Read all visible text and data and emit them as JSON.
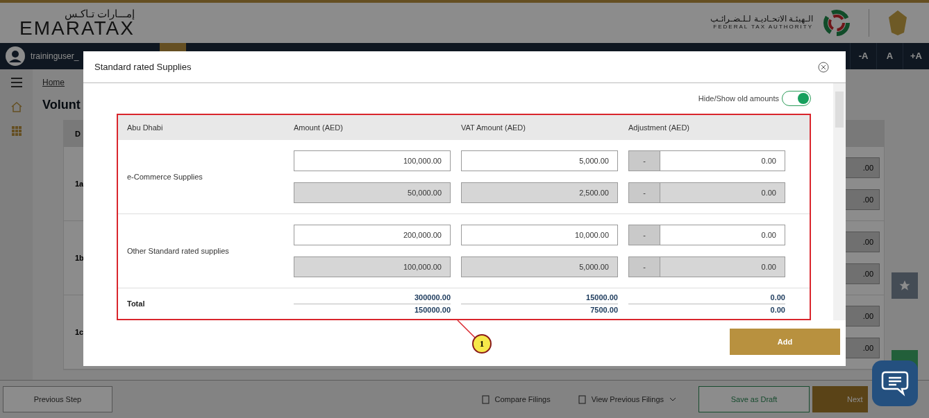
{
  "header": {
    "logo_arabic": "إمـــارات تـاكـس",
    "logo_text": "EMARATAX",
    "authority_arabic": "الـهيئـة الاتحـاديـة لـلـضـرائـب",
    "authority_english": "FEDERAL TAX AUTHORITY"
  },
  "navbar": {
    "user": "traininguser_",
    "font_buttons": [
      "-A",
      "A",
      "+A"
    ]
  },
  "breadcrumb": [
    "Home"
  ],
  "page_title": "Volunt",
  "background_table": {
    "header": "D",
    "rows": [
      {
        "label": "1a",
        "values": [
          ".00",
          ".00"
        ]
      },
      {
        "label": "1b",
        "values": [
          ".00",
          ".00"
        ]
      },
      {
        "label": "1c",
        "values": [
          ".00",
          ".00"
        ]
      }
    ]
  },
  "footer": {
    "previous": "Previous Step",
    "links": [
      "Compare Filings",
      "View Previous Filings"
    ],
    "save": "Save as Draft",
    "next": "Next"
  },
  "modal": {
    "title": "Standard rated Supplies",
    "toggle": {
      "label": "Hide/Show old amounts",
      "on": true
    },
    "columns": [
      "Abu Dhabi",
      "Amount (AED)",
      "VAT Amount (AED)",
      "Adjustment (AED)"
    ],
    "rows": [
      {
        "label": "e-Commerce Supplies",
        "entries": [
          {
            "kind": "current",
            "amount": "100,000.00",
            "vat": "5,000.00",
            "sign": "-",
            "adjustment": "0.00"
          },
          {
            "kind": "old",
            "amount": "50,000.00",
            "vat": "2,500.00",
            "sign": "-",
            "adjustment": "0.00"
          }
        ]
      },
      {
        "label": "Other Standard rated supplies",
        "entries": [
          {
            "kind": "current",
            "amount": "200,000.00",
            "vat": "10,000.00",
            "sign": "-",
            "adjustment": "0.00"
          },
          {
            "kind": "old",
            "amount": "100,000.00",
            "vat": "5,000.00",
            "sign": "-",
            "adjustment": "0.00"
          }
        ]
      }
    ],
    "total": {
      "label": "Total",
      "amount": [
        "300000.00",
        "150000.00"
      ],
      "vat": [
        "15000.00",
        "7500.00"
      ],
      "adjustment": [
        "0.00",
        "0.00"
      ]
    },
    "add_button": "Add",
    "annotation": "1"
  }
}
